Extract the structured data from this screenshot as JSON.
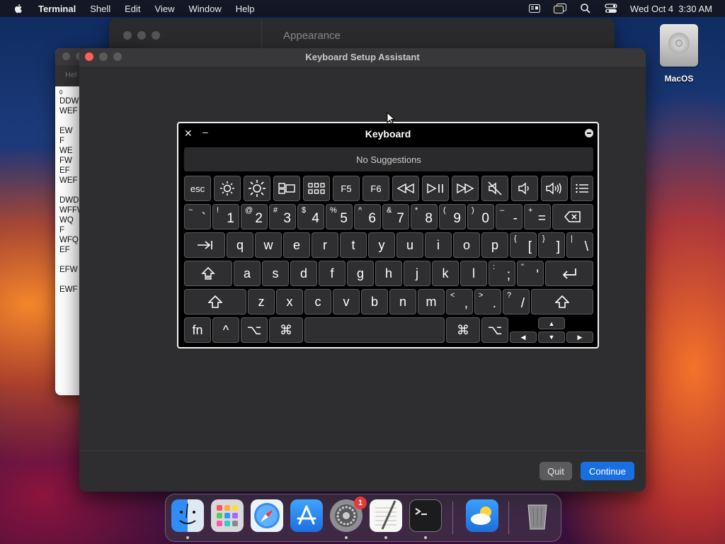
{
  "menubar": {
    "app_name": "Terminal",
    "menus": [
      "Shell",
      "Edit",
      "View",
      "Window",
      "Help"
    ],
    "clock": "Wed Oct 4  3:30 AM"
  },
  "desktop": {
    "disk_label": "MacOS"
  },
  "appearance_window": {
    "title": "Appearance"
  },
  "terminal_window": {
    "subtitle": "Hel",
    "lines": [
      "0",
      "DDW",
      "WEF",
      "",
      "EW",
      "F",
      "WE",
      "FW",
      "EF",
      "WEF",
      "",
      "DWD",
      "WFFW",
      "WQ",
      "F",
      "WFQ",
      "EF",
      "",
      "EFW",
      "",
      "EWF"
    ]
  },
  "assistant": {
    "title": "Keyboard Setup Assistant",
    "quit_label": "Quit",
    "continue_label": "Continue"
  },
  "keyboard": {
    "title": "Keyboard",
    "suggestions": "No Suggestions",
    "fn_row": [
      "esc",
      "brightness-down-icon",
      "brightness-up-icon",
      "mission-control-icon",
      "launchpad-icon",
      "F5",
      "F6",
      "rewind-icon",
      "play-pause-icon",
      "fast-forward-icon",
      "mute-icon",
      "volume-down-icon",
      "volume-up-icon",
      "list-icon"
    ],
    "number_row": [
      {
        "top": "~",
        "bot": "`"
      },
      {
        "top": "!",
        "bot": "1"
      },
      {
        "top": "@",
        "bot": "2"
      },
      {
        "top": "#",
        "bot": "3"
      },
      {
        "top": "$",
        "bot": "4"
      },
      {
        "top": "%",
        "bot": "5"
      },
      {
        "top": "^",
        "bot": "6"
      },
      {
        "top": "&",
        "bot": "7"
      },
      {
        "top": "*",
        "bot": "8"
      },
      {
        "top": "(",
        "bot": "9"
      },
      {
        "top": ")",
        "bot": "0"
      },
      {
        "top": "–",
        "bot": "-"
      },
      {
        "top": "+",
        "bot": "="
      }
    ],
    "row_q": [
      "q",
      "w",
      "e",
      "r",
      "t",
      "y",
      "u",
      "i",
      "o",
      "p"
    ],
    "row_q_sym": [
      {
        "top": "{",
        "bot": "["
      },
      {
        "top": "}",
        "bot": "]"
      },
      {
        "top": "|",
        "bot": "\\"
      }
    ],
    "row_a": [
      "a",
      "s",
      "d",
      "f",
      "g",
      "h",
      "j",
      "k",
      "l"
    ],
    "row_a_sym": [
      {
        "top": ":",
        "bot": ";"
      },
      {
        "top": "\"",
        "bot": "'"
      }
    ],
    "row_z": [
      "z",
      "x",
      "c",
      "v",
      "b",
      "n",
      "m"
    ],
    "row_z_sym": [
      {
        "top": "<",
        "bot": ","
      },
      {
        "top": ">",
        "bot": "."
      },
      {
        "top": "?",
        "bot": "/"
      }
    ],
    "bottom": {
      "fn": "fn",
      "control": "^",
      "option": "⌥",
      "command": "⌘"
    }
  },
  "dock": {
    "apps": [
      "Finder",
      "Launchpad",
      "Safari",
      "App Store",
      "System Settings",
      "TextEdit",
      "Terminal",
      "Weather",
      "Trash"
    ],
    "settings_badge": "1"
  },
  "colors": {
    "accent": "#1a6fe0",
    "close_red": "#ff5f57"
  }
}
